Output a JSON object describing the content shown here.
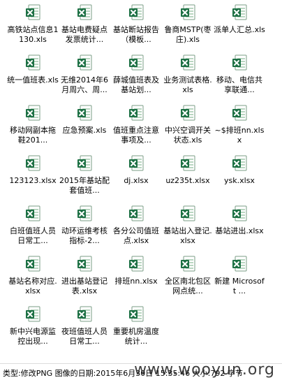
{
  "files": [
    {
      "name": "高铁站点信息1130.xls"
    },
    {
      "name": "基站电费疑点发票统计..."
    },
    {
      "name": "基站断站报告（模板..."
    },
    {
      "name": "鲁商MSTP(枣庄).xls"
    },
    {
      "name": "派单人汇总.xls"
    },
    {
      "name": "统一值班表.xls"
    },
    {
      "name": "无维2014年6月周六、周..."
    },
    {
      "name": "薛城值班表及基站划..."
    },
    {
      "name": "业务测试表格.xls"
    },
    {
      "name": "移动、电信共享联通..."
    },
    {
      "name": "移动网副本拖鞋201..."
    },
    {
      "name": "应急预案.xls"
    },
    {
      "name": "值班重点注意事项及..."
    },
    {
      "name": "中兴空调开关状态.xls"
    },
    {
      "name": "~$排班nn.xlsx"
    },
    {
      "name": "123123.xlsx"
    },
    {
      "name": "2015年基站配套值班..."
    },
    {
      "name": "dj.xlsx"
    },
    {
      "name": "uz235t.xlsx"
    },
    {
      "name": "ysk.xlsx"
    },
    {
      "name": "白班值班人员日常工..."
    },
    {
      "name": "动环运维考核指标-2..."
    },
    {
      "name": "各分公司值班点.xlsx"
    },
    {
      "name": "基站出入登记.xlsx"
    },
    {
      "name": "基站进出.xlsx"
    },
    {
      "name": "基站名称对应.xlsx"
    },
    {
      "name": "进出基站登记表.xlsx"
    },
    {
      "name": "排班nn.xlsx"
    },
    {
      "name": "全区南北包区网点统..."
    },
    {
      "name": "新建 Microsoft ..."
    },
    {
      "name": "新中兴电源监控出现..."
    },
    {
      "name": "夜班值班人员日常工..."
    },
    {
      "name": "重要机房温度统计..."
    }
  ],
  "statusbar": {
    "text": "类型:修改PNG 图像的日期:2015年6月30日 15:35:46 大小:792 字节"
  },
  "watermark": "www.wooyun.org",
  "colors": {
    "excel_green": "#1e7145",
    "excel_light": "#3c9a5f"
  }
}
